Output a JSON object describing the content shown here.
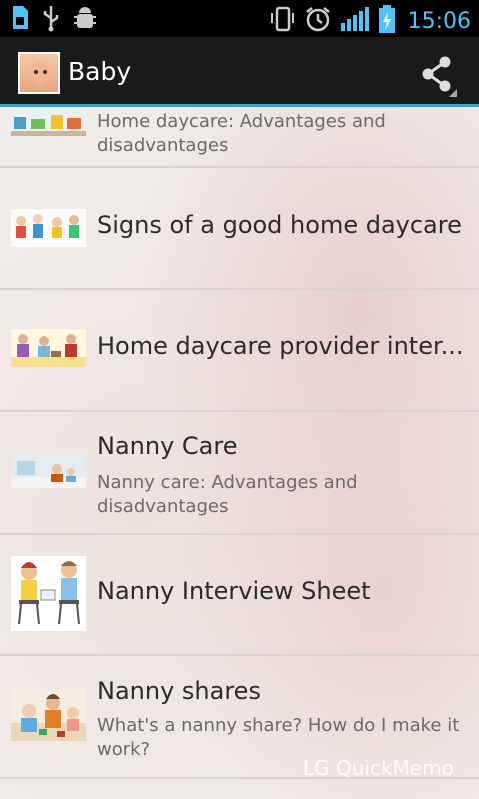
{
  "status_bar": {
    "time": "15:06",
    "icons": [
      "sim-card-icon",
      "usb-icon",
      "android-debug-icon",
      "vibrate-icon",
      "alarm-icon",
      "signal-icon",
      "battery-charging-icon"
    ]
  },
  "action_bar": {
    "title": "Baby",
    "share_icon": "share-icon"
  },
  "list": [
    {
      "title": "",
      "subtitle": "Home daycare: Advantages and disadvantages"
    },
    {
      "title": "Signs of a good home daycare",
      "subtitle": ""
    },
    {
      "title": "Home daycare provider inter...",
      "subtitle": ""
    },
    {
      "title": "Nanny Care",
      "subtitle": "Nanny care: Advantages and disadvantages"
    },
    {
      "title": "Nanny Interview Sheet",
      "subtitle": ""
    },
    {
      "title": "Nanny shares",
      "subtitle": "What's a nanny share? How do I make it work?"
    }
  ],
  "watermark": "LG QuickMemo",
  "colors": {
    "accent": "#3aa0d0",
    "status_icon": "#4fc3f7"
  }
}
